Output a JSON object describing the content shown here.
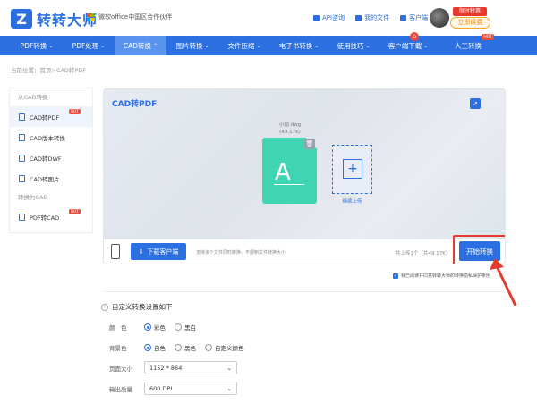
{
  "header": {
    "logo_mark": "Z",
    "logo_text": "转转大师",
    "partner_text": "微软office中国区合作伙伴",
    "links": [
      "API咨询",
      "我的文件",
      "客户端"
    ],
    "promo_badge": "限时特惠",
    "vip_button": "立即续费"
  },
  "nav": {
    "items": [
      {
        "label": "PDF转换",
        "caret": "⌄"
      },
      {
        "label": "PDF处理",
        "caret": "⌄"
      },
      {
        "label": "CAD转换",
        "caret": "⌃"
      },
      {
        "label": "图片转换",
        "caret": "⌄"
      },
      {
        "label": "文件压缩",
        "caret": "⌄"
      },
      {
        "label": "电子书转换",
        "caret": "⌄"
      },
      {
        "label": "使用技巧",
        "caret": "⌄"
      },
      {
        "label": "客户端下载",
        "caret": "⌄"
      },
      {
        "label": "人工转换",
        "caret": ""
      }
    ],
    "active_index": 2,
    "hot_badge": "HOT"
  },
  "breadcrumb": "当前位置：首页>CAD转PDF",
  "sidebar": {
    "group1": "从CAD转换",
    "items1": [
      {
        "label": "CAD转PDF",
        "hot": "HOT"
      },
      {
        "label": "CAD版本转换",
        "hot": ""
      },
      {
        "label": "CAD转DWF",
        "hot": ""
      },
      {
        "label": "CAD转图片",
        "hot": ""
      }
    ],
    "group2": "转换为CAD",
    "items2": [
      {
        "label": "PDF转CAD",
        "hot": "HOT"
      }
    ]
  },
  "panel": {
    "title": "CAD转PDF",
    "file_name": "小题.dwg",
    "file_size": "(49.17K)",
    "file_glyph": "A",
    "add_label": "继续上传",
    "download_button": "下载客户端",
    "bar_note": "支持多个文件同时转换，不限制文件转换大小",
    "count_text": "共上传1个（共49.17K）",
    "start_button": "开始转换",
    "agree_text": "我已阅读并同意转转大师的转换隐私保护条例"
  },
  "settings": {
    "title": "自定义转换设置如下",
    "color_label": "颜　色",
    "color_options": [
      "彩色",
      "黑白"
    ],
    "color_selected": 0,
    "bg_label": "背景色",
    "bg_options": [
      "白色",
      "黑色",
      "自定义颜色"
    ],
    "bg_selected": 0,
    "page_label": "页面大小",
    "page_value": "1152 * 864",
    "quality_label": "输出质量",
    "quality_value": "600 DPI"
  },
  "colors": {
    "brand": "#2b6fe0",
    "highlight": "#e53b2f",
    "file_icon": "#3fd5b2"
  }
}
